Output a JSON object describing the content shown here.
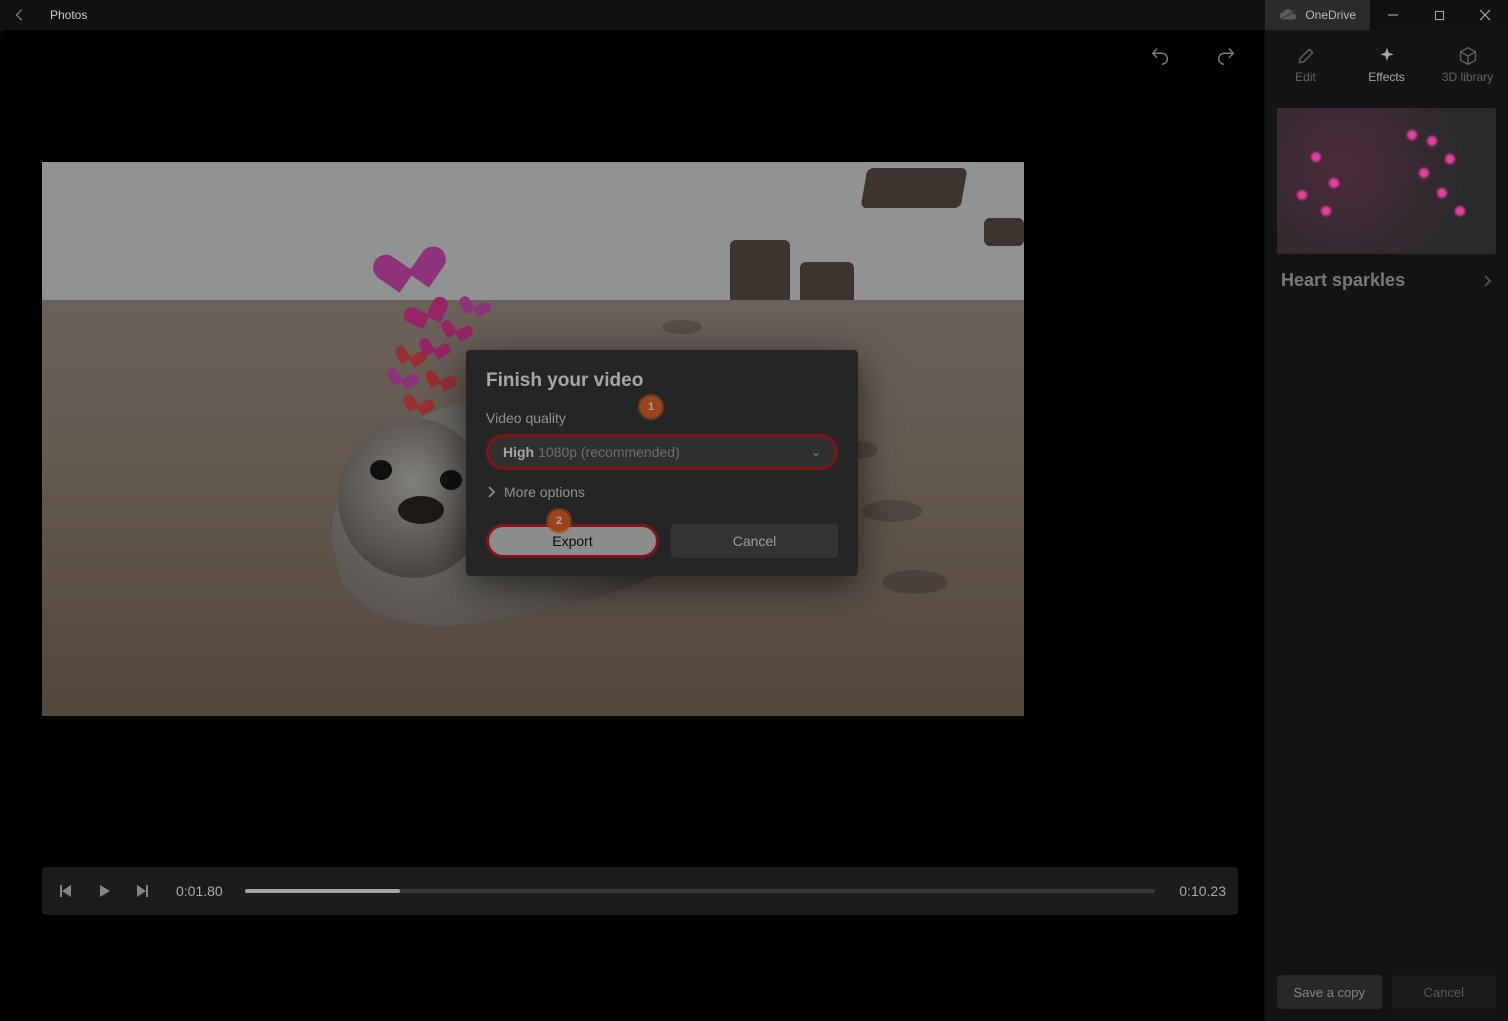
{
  "titlebar": {
    "app_name": "Photos",
    "onedrive_label": "OneDrive"
  },
  "sidebar": {
    "tabs": {
      "edit": "Edit",
      "effects": "Effects",
      "library": "3D library"
    },
    "effect_name": "Heart sparkles",
    "footer": {
      "save": "Save a copy",
      "cancel": "Cancel"
    }
  },
  "playbar": {
    "current_time": "0:01.80",
    "duration": "0:10.23"
  },
  "dialog": {
    "title": "Finish your video",
    "quality_label": "Video quality",
    "quality_value_prefix": "High",
    "quality_value_suffix": "1080p (recommended)",
    "more_options": "More options",
    "export": "Export",
    "cancel": "Cancel"
  },
  "annotations": {
    "badge1": "1",
    "badge2": "2"
  }
}
